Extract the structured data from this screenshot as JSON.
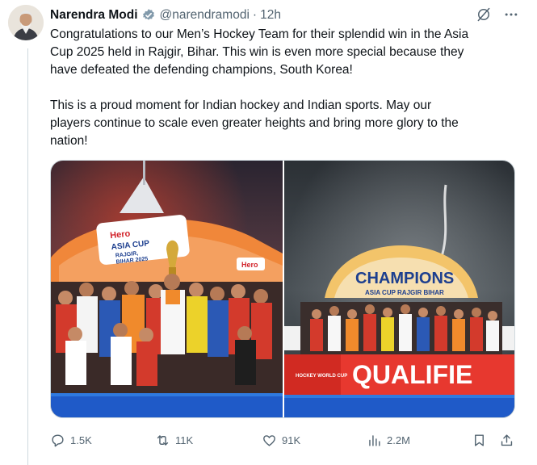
{
  "author": {
    "name": "Narendra Modi",
    "handle": "@narendramodi",
    "separator": "·",
    "time": "12h"
  },
  "tweet": {
    "paragraph_1": "Congratulations to our Men’s Hockey Team for their splendid win in the Asia\nCup 2025 held in Rajgir, Bihar. This win is even more special because they\nhave defeated the defending champions, South Korea!",
    "paragraph_2": "This is a proud moment for Indian hockey and Indian sports. May our\nplayers continue to scale even greater heights and bring more glory to the\nnation!"
  },
  "media": {
    "photo_1": {
      "banner_brand": "Hero",
      "banner_title": "ASIA CUP",
      "banner_sub": "RAJGIR,",
      "banner_sub2": "BIHAR 2025",
      "board_text": "Hero"
    },
    "photo_2": {
      "arch_title": "CHAMPIONS",
      "arch_sub": "ASIA CUP RAJGIR BIHAR",
      "board_text": "QUALIFIE",
      "wc_text": "HOCKEY WORLD CUP"
    }
  },
  "stats": {
    "replies": "1.5K",
    "reposts": "11K",
    "likes": "91K",
    "views": "2.2M"
  },
  "colors": {
    "text": "#0f1419",
    "secondary": "#536471",
    "verified": "#829aab",
    "border": "#cfd9de"
  }
}
